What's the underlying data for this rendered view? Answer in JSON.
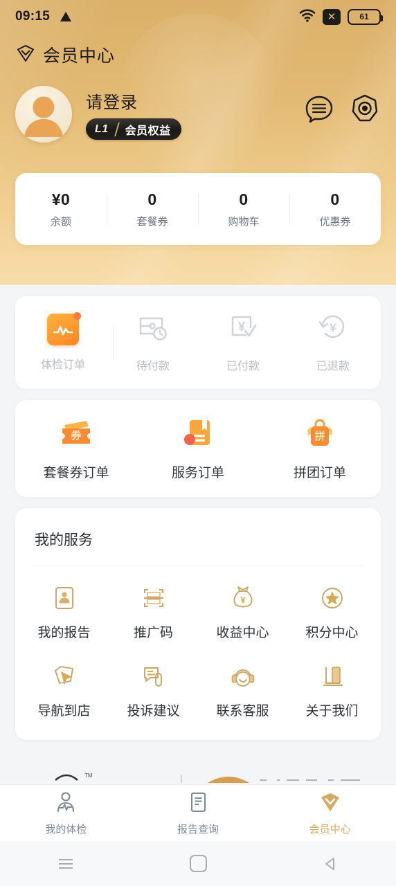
{
  "statusbar": {
    "time": "09:15",
    "warning_icon": "warning-triangle-icon",
    "wifi_icon": "wifi-icon",
    "nosim_label": "✕",
    "battery_level": "61"
  },
  "header": {
    "brand_icon": "diamond-shield-icon",
    "title": "会员中心"
  },
  "profile": {
    "avatar_icon": "user-avatar-placeholder-icon",
    "login_prompt": "请登录",
    "level_label": "L1",
    "benefits_label": "会员权益",
    "message_icon": "chat-bubble-icon",
    "settings_icon": "hexagon-settings-icon"
  },
  "stats": [
    {
      "value": "¥0",
      "label": "余额"
    },
    {
      "value": "0",
      "label": "套餐券"
    },
    {
      "value": "0",
      "label": "购物车"
    },
    {
      "value": "0",
      "label": "优惠券"
    }
  ],
  "orders_primary": [
    {
      "label": "体检订单",
      "icon": "health-exam-pulse-icon"
    },
    {
      "label": "待付款",
      "icon": "wallet-clock-icon"
    },
    {
      "label": "已付款",
      "icon": "yuan-check-icon"
    },
    {
      "label": "已退款",
      "icon": "yuan-refund-icon"
    }
  ],
  "orders_secondary": [
    {
      "label": "套餐券订单",
      "icon": "coupon-ticket-icon"
    },
    {
      "label": "服务订单",
      "icon": "service-book-icon"
    },
    {
      "label": "拼团订单",
      "icon": "group-buy-bag-icon"
    }
  ],
  "services": {
    "title": "我的服务",
    "items": [
      {
        "label": "我的报告",
        "icon": "report-person-icon"
      },
      {
        "label": "推广码",
        "icon": "qr-scan-icon"
      },
      {
        "label": "收益中心",
        "icon": "money-bag-icon"
      },
      {
        "label": "积分中心",
        "icon": "star-circle-icon"
      },
      {
        "label": "导航到店",
        "icon": "navigation-cursor-icon"
      },
      {
        "label": "投诉建议",
        "icon": "feedback-hand-icon"
      },
      {
        "label": "联系客服",
        "icon": "headset-support-icon"
      },
      {
        "label": "关于我们",
        "icon": "about-door-icon"
      }
    ]
  },
  "tabbar": [
    {
      "label": "我的体检",
      "icon": "person-pulse-icon",
      "active": false
    },
    {
      "label": "报告查询",
      "icon": "document-lines-icon",
      "active": false
    },
    {
      "label": "会员中心",
      "icon": "diamond-icon",
      "active": true
    }
  ],
  "androidnav": [
    {
      "icon": "recents-menu-icon"
    },
    {
      "icon": "home-square-icon"
    },
    {
      "icon": "back-triangle-icon"
    }
  ],
  "colors": {
    "gold": "#d6a95e",
    "gold_header_top": "#dbb069",
    "gold_header_bottom": "#f8ddaa",
    "orange": "#fb8526",
    "page_bg": "#f4f5f6",
    "text_dark": "#1d1d1d",
    "text_muted": "#6b7480",
    "disabled": "#b9bcc0"
  }
}
